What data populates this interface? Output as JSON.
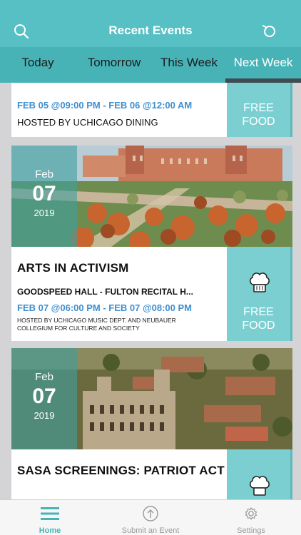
{
  "header": {
    "title": "Recent Events"
  },
  "tabs": [
    "Today",
    "Tomorrow",
    "This Week",
    "Next Week"
  ],
  "events": [
    {
      "time": "FEB 05 @09:00 PM - FEB 06 @12:00 AM",
      "host": "HOSTED BY UCHICAGO DINING",
      "badge": "FREE\nFOOD"
    },
    {
      "month": "Feb",
      "day": "07",
      "year": "2019",
      "name": "ARTS IN ACTIVISM",
      "location": "GOODSPEED HALL - FULTON RECITAL H...",
      "time": "FEB 07 @06:00 PM - FEB 07 @08:00 PM",
      "host": "HOSTED BY UCHICAGO MUSIC DEPT. AND NEUBAUER COLLEGIUM FOR CULTURE AND SOCIETY",
      "badge": "FREE\nFOOD"
    },
    {
      "month": "Feb",
      "day": "07",
      "year": "2019",
      "name": "SASA SCREENINGS: PATRIOT ACT"
    }
  ],
  "bottom_nav": [
    {
      "label": "Home",
      "icon": "menu-icon"
    },
    {
      "label": "Submit an Event",
      "icon": "upload-icon"
    },
    {
      "label": "Settings",
      "icon": "gear-icon"
    }
  ],
  "colors": {
    "header": "#56c0c4",
    "tabs": "#48b3b7",
    "accent": "#3f8fd0",
    "badge": "#7ccfd1"
  }
}
